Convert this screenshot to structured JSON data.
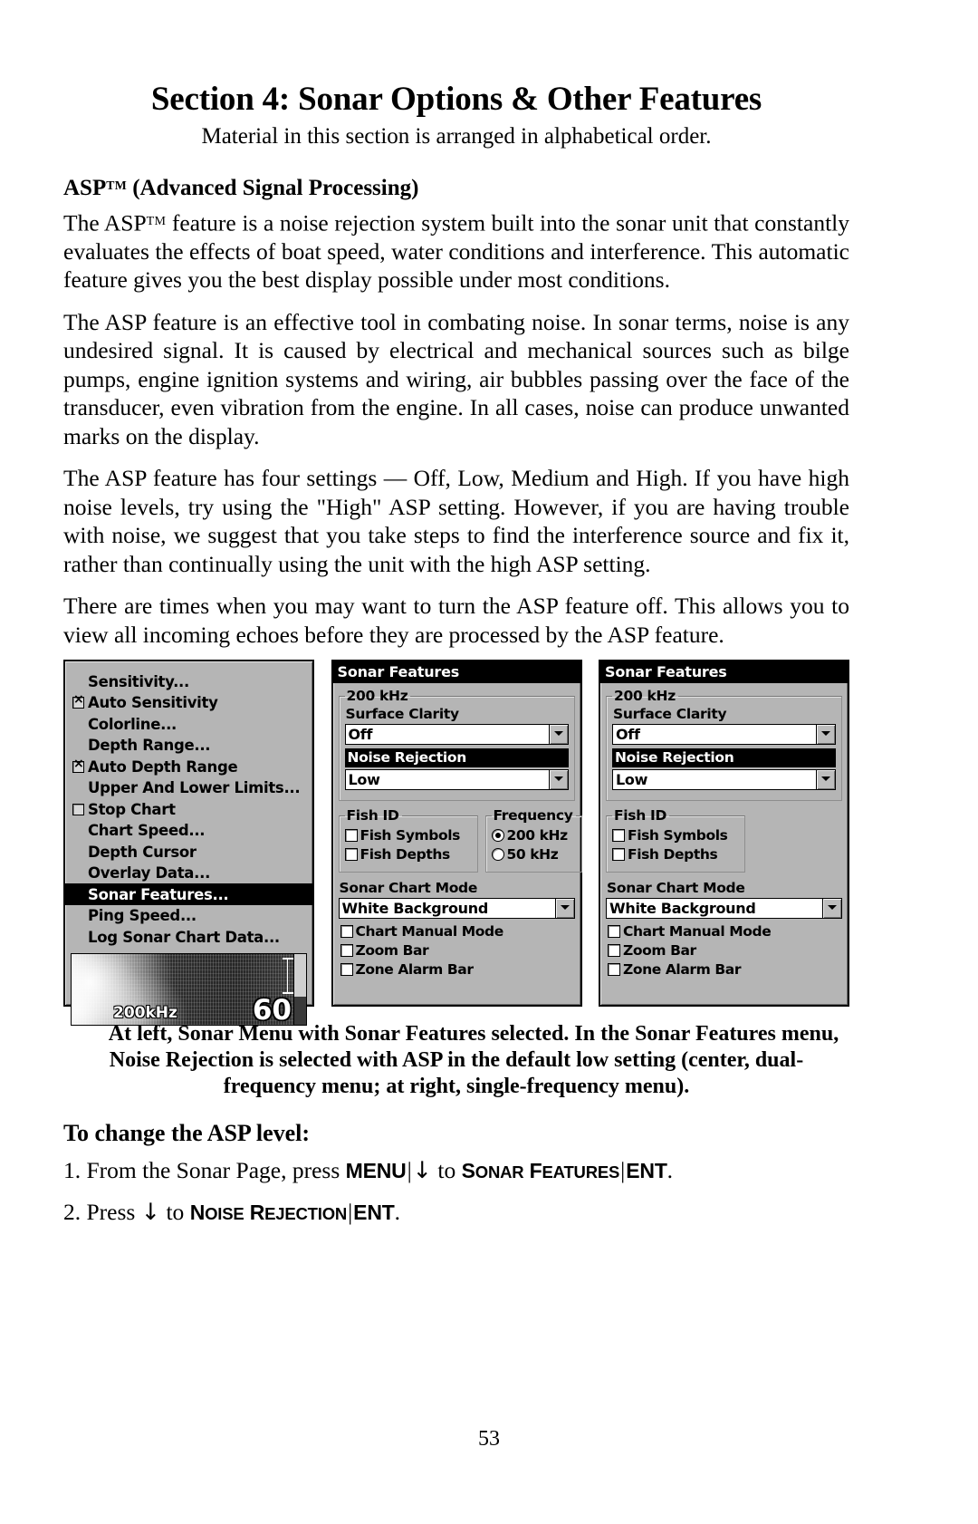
{
  "page": {
    "section_title": "Section 4: Sonar Options & Other Features",
    "subtitle": "Material in this section is arranged in alphabetical order.",
    "page_number": "53"
  },
  "headings": {
    "asp": "ASP",
    "asp_tm": "TM",
    "asp_rest": " (Advanced Signal Processing)",
    "to_change": "To change the ASP level:"
  },
  "paragraphs": {
    "p1_a": "The ASP",
    "p1_tm": "TM",
    "p1_b": " feature is a noise rejection system built into the sonar unit that constantly evaluates the effects of boat speed, water conditions and interference. This automatic feature gives you the best display possible under most conditions.",
    "p2": "The ASP feature is an effective tool in combating noise. In sonar terms, noise is any undesired signal. It is caused by electrical and mechanical sources such as bilge pumps, engine ignition systems and wiring, air bubbles passing over the face of the transducer, even vibration from the engine. In all cases, noise can produce unwanted marks on the display.",
    "p3": "The ASP feature has four settings — Off, Low, Medium and High. If you have high noise levels, try using the \"High\" ASP setting. However, if you are having trouble with noise, we suggest that you take steps to find the interference source and fix it, rather than continually using the unit with the high ASP setting.",
    "p4": "There are times when you may want to turn the ASP feature off. This allows you to view all incoming echoes before they are processed by the ASP feature."
  },
  "sonar_menu": {
    "items": [
      {
        "label": "Sensitivity...",
        "control": "none",
        "checked": false
      },
      {
        "label": "Auto Sensitivity",
        "control": "checkbox",
        "checked": true
      },
      {
        "label": "Colorline...",
        "control": "none",
        "checked": false
      },
      {
        "label": "Depth Range...",
        "control": "none",
        "checked": false
      },
      {
        "label": "Auto Depth Range",
        "control": "checkbox",
        "checked": true
      },
      {
        "label": "Upper And Lower Limits...",
        "control": "none",
        "checked": false
      },
      {
        "label": "Stop Chart",
        "control": "checkbox",
        "checked": false
      },
      {
        "label": "Chart Speed...",
        "control": "none",
        "checked": false
      },
      {
        "label": "Depth Cursor",
        "control": "none",
        "checked": false
      },
      {
        "label": "Overlay Data...",
        "control": "none",
        "checked": false
      },
      {
        "label": "Sonar Features...",
        "control": "none",
        "checked": false,
        "selected": true
      },
      {
        "label": "Ping Speed...",
        "control": "none",
        "checked": false
      },
      {
        "label": "Log Sonar Chart Data...",
        "control": "none",
        "checked": false
      }
    ],
    "chart_preview": {
      "frequency_label": "200kHz",
      "depth_value": "60"
    }
  },
  "dual_freq_dialog": {
    "title": "Sonar Features",
    "group_freq_legend": "200 kHz",
    "surface_clarity_label": "Surface Clarity",
    "surface_clarity_value": "Off",
    "noise_rejection_label": "Noise Rejection",
    "noise_rejection_value": "Low",
    "fish_id_legend": "Fish ID",
    "fish_symbols_label": "Fish Symbols",
    "fish_depths_label": "Fish Depths",
    "frequency_legend": "Frequency",
    "freq_200_label": "200 kHz",
    "freq_50_label": "50 kHz",
    "sonar_chart_mode_label": "Sonar Chart Mode",
    "sonar_chart_mode_value": "White Background",
    "chart_manual_mode_label": "Chart Manual Mode",
    "zoom_bar_label": "Zoom Bar",
    "zone_alarm_bar_label": "Zone Alarm Bar"
  },
  "single_freq_dialog": {
    "title": "Sonar Features",
    "group_freq_legend": "200 kHz",
    "surface_clarity_label": "Surface Clarity",
    "surface_clarity_value": "Off",
    "noise_rejection_label": "Noise Rejection",
    "noise_rejection_value": "Low",
    "fish_id_legend": "Fish ID",
    "fish_symbols_label": "Fish Symbols",
    "fish_depths_label": "Fish Depths",
    "sonar_chart_mode_label": "Sonar Chart Mode",
    "sonar_chart_mode_value": "White Background",
    "chart_manual_mode_label": "Chart Manual Mode",
    "zoom_bar_label": "Zoom Bar",
    "zone_alarm_bar_label": "Zone Alarm Bar"
  },
  "caption": {
    "line1": "At left, Sonar Menu with Sonar Features selected. In the Sonar",
    "line2": "Features menu, Noise Rejection is selected with ASP in the default low",
    "line3": "setting (center, dual-frequency menu; at right, single-frequency menu)."
  },
  "steps": {
    "step1_pre": "1. From the Sonar Page, press ",
    "step1_key1": "MENU",
    "step1_mid": " to ",
    "step1_key2_a": "S",
    "step1_key2_b": "ONAR",
    "step1_key2_c": " F",
    "step1_key2_d": "EATURES",
    "step1_key3": "ENT",
    "step1_end": ".",
    "step2_pre": "2. Press ",
    "step2_mid": " to ",
    "step2_key1_a": "N",
    "step2_key1_b": "OISE",
    "step2_key1_c": " R",
    "step2_key1_d": "EJECTION",
    "step2_key2": "ENT",
    "step2_end": ".",
    "down_arrow": "↓",
    "pipe": "|"
  },
  "colors": {
    "lcd_background": "#b5b5b5",
    "selection": "#000000",
    "field_background": "#ffffff"
  }
}
